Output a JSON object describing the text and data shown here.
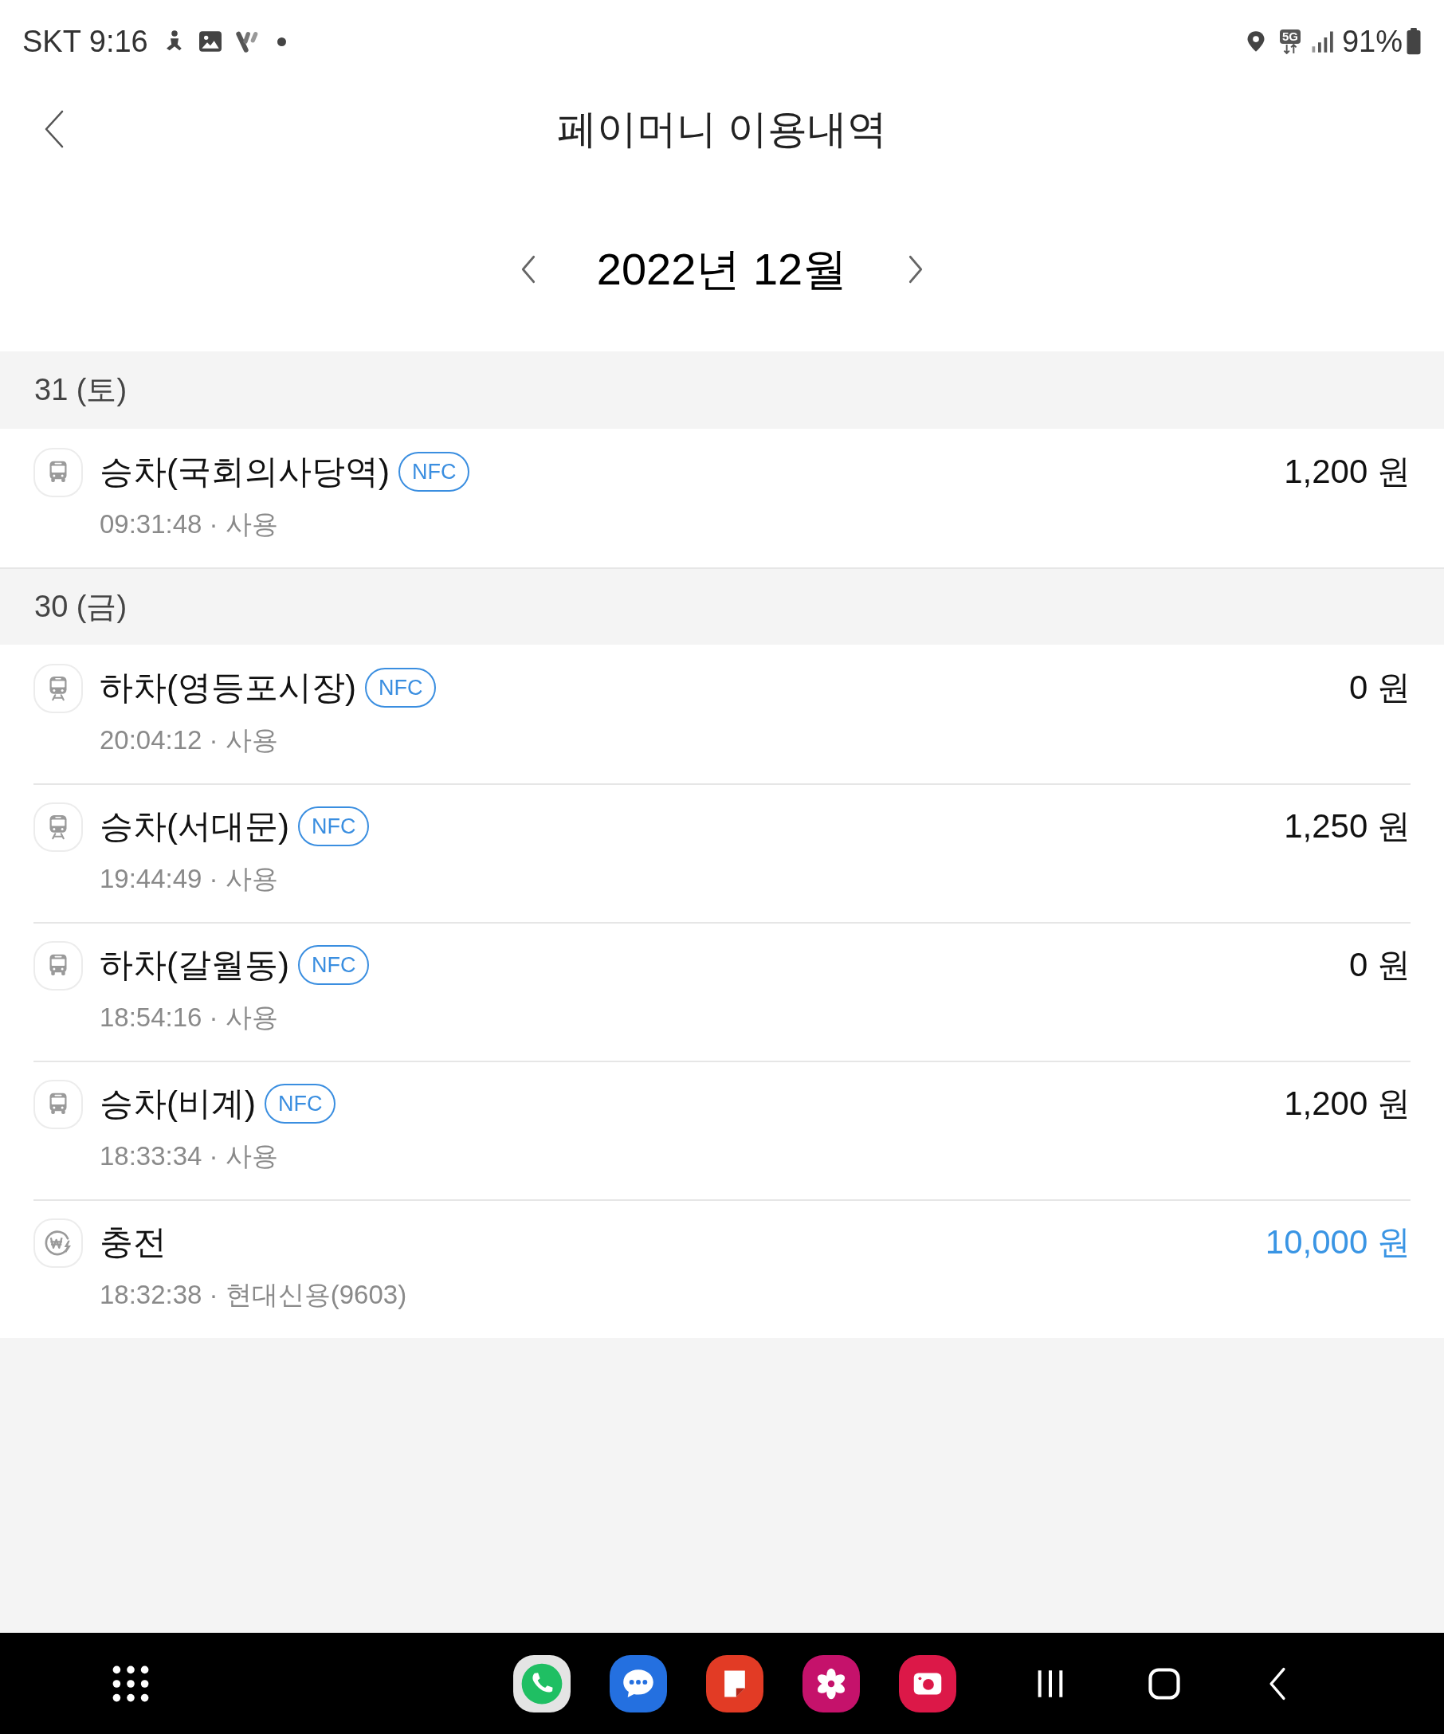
{
  "status_bar": {
    "carrier_time": "SKT 9:16",
    "network": "5G",
    "battery": "91%"
  },
  "header": {
    "title": "페이머니 이용내역"
  },
  "month_nav": {
    "label": "2022년 12월"
  },
  "days": [
    {
      "date": "31 (토)",
      "items": [
        {
          "kind": "bus",
          "title": "승차(국회의사당역)",
          "badge": "NFC",
          "subtitle": "09:31:48 · 사용",
          "amount": "1,200 원"
        }
      ]
    },
    {
      "date": "30 (금)",
      "items": [
        {
          "kind": "subway",
          "title": "하차(영등포시장)",
          "badge": "NFC",
          "subtitle": "20:04:12 · 사용",
          "amount": "0 원"
        },
        {
          "kind": "subway",
          "title": "승차(서대문)",
          "badge": "NFC",
          "subtitle": "19:44:49 · 사용",
          "amount": "1,250 원"
        },
        {
          "kind": "bus",
          "title": "하차(갈월동)",
          "badge": "NFC",
          "subtitle": "18:54:16 · 사용",
          "amount": "0 원"
        },
        {
          "kind": "bus",
          "title": "승차(비계)",
          "badge": "NFC",
          "subtitle": "18:33:34 · 사용",
          "amount": "1,200 원"
        },
        {
          "kind": "charge",
          "title": "충전",
          "subtitle": "18:32:38 · 현대신용(9603)",
          "amount": "10,000 원"
        }
      ]
    }
  ]
}
